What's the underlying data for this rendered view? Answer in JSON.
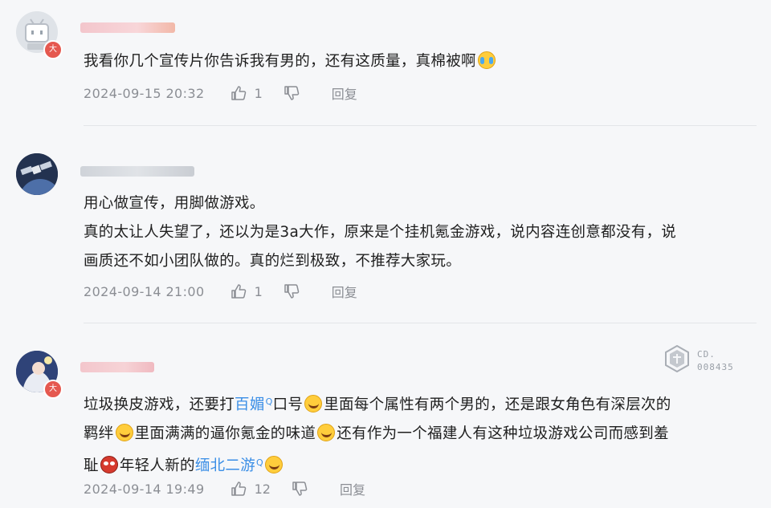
{
  "comments": [
    {
      "user_badge": "大",
      "text_parts": [
        "我看你几个宣传片你告诉我有男的，还有这质量，真棉被啊"
      ],
      "emoji_names": [
        "crying-emoji"
      ],
      "time": "2024-09-15 20:32",
      "likes": "1",
      "reply_label": "回复"
    },
    {
      "text_lines": [
        "用心做宣传，用脚做游戏。",
        "真的太让人失望了，还以为是3a大作，原来是个挂机氪金游戏，说内容连创意都没有，说",
        "画质还不如小团队做的。真的烂到极致，不推荐大家玩。"
      ],
      "time": "2024-09-14 21:00",
      "likes": "1",
      "reply_label": "回复"
    },
    {
      "user_badge": "大",
      "segments": {
        "a": "垃圾换皮游戏，还要打",
        "link1": "百媚",
        "b": "口号",
        "c": "里面每个属性有两个男的，还是跟女角色有深层次的",
        "d": "羁绊",
        "e": "里面满满的逼你氪金的味道",
        "f": "还有作为一个福建人有这种垃圾游戏公司而感到羞",
        "g": "耻",
        "h": "年轻人新的",
        "link2": "缅北二游"
      },
      "search_mark": "Q",
      "emoji_names": [
        "laughing-emoji",
        "spider-emoji"
      ],
      "time": "2024-09-14 19:49",
      "likes": "12",
      "reply_label": "回复"
    }
  ],
  "watermark": {
    "line1": "CD.",
    "line2": "008435"
  },
  "colors": {
    "link": "#3a8ee6",
    "meta": "#8b8e94",
    "badge": "#e5584f",
    "background": "#f6f7f9"
  }
}
